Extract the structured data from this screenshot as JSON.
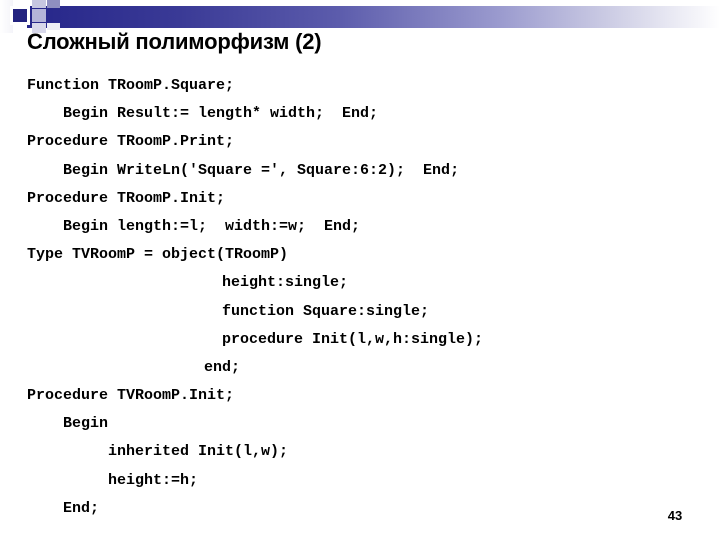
{
  "slide": {
    "title": "Сложный полиморфизм (2)",
    "number": "43",
    "colors": {
      "band_start": "#26268a",
      "band_end": "#ffffff",
      "deco_square": "#23237f",
      "text": "#000000",
      "background": "#ffffff"
    }
  },
  "code": {
    "lines": [
      {
        "text": "Function TRoomP.Square;",
        "indent": 0
      },
      {
        "text": "Begin Result:= length* width;  End;",
        "indent": 36
      },
      {
        "text": "Procedure TRoomP.Print;",
        "indent": 0
      },
      {
        "text": "Begin WriteLn('Square =', Square:6:2);  End;",
        "indent": 36
      },
      {
        "text": "Procedure TRoomP.Init;",
        "indent": 0
      },
      {
        "text": "Begin length:=l;  width:=w;  End;",
        "indent": 36
      },
      {
        "text": "Type TVRoomP = object(TRoomP)",
        "indent": 0
      },
      {
        "text": "height:single;",
        "indent": 195
      },
      {
        "text": "function Square:single;",
        "indent": 195
      },
      {
        "text": "procedure Init(l,w,h:single);",
        "indent": 195
      },
      {
        "text": "end;",
        "indent": 177
      },
      {
        "text": "Procedure TVRoomP.Init;",
        "indent": 0
      },
      {
        "text": "Begin",
        "indent": 36
      },
      {
        "text": "inherited Init(l,w);",
        "indent": 81
      },
      {
        "text": "height:=h;",
        "indent": 81
      },
      {
        "text": "End;",
        "indent": 36
      }
    ]
  }
}
